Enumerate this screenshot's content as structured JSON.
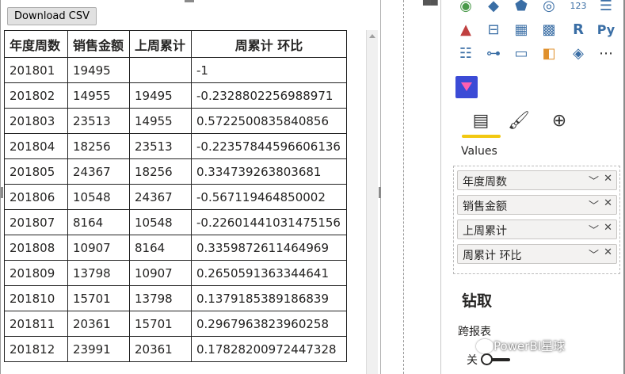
{
  "visual": {
    "download_label": "Download CSV",
    "columns": [
      "年度周数",
      "销售金额",
      "上周累计",
      "周累计 环比"
    ],
    "rows": [
      [
        "201801",
        "19495",
        "",
        "-1"
      ],
      [
        "201802",
        "14955",
        "19495",
        "-0.2328802256988971"
      ],
      [
        "201803",
        "23513",
        "14955",
        "0.5722500835840856"
      ],
      [
        "201804",
        "18256",
        "23513",
        "-0.22357844596606136"
      ],
      [
        "201805",
        "24367",
        "18256",
        "0.334739263803681"
      ],
      [
        "201806",
        "10548",
        "24367",
        "-0.567119464850002"
      ],
      [
        "201807",
        "8164",
        "10548",
        "-0.22601441031475156"
      ],
      [
        "201808",
        "10907",
        "8164",
        "0.3359872611464969"
      ],
      [
        "201809",
        "13798",
        "10907",
        "0.2650591363344641"
      ],
      [
        "201810",
        "15701",
        "13798",
        "0.1379185389186839"
      ],
      [
        "201811",
        "20361",
        "15701",
        "0.2967963823960258"
      ],
      [
        "201812",
        "23991",
        "20361",
        "0.17828200972447328"
      ]
    ]
  },
  "pane": {
    "values_label": "Values",
    "wells": [
      "年度周数",
      "销售金额",
      "上周累计",
      "周累计 环比"
    ],
    "drill_title": "钻取",
    "cross_report_label": "跨报表",
    "toggle_off_label": "关",
    "accent": "#f2c811",
    "icons": [
      "globe-map-icon",
      "filled-map-icon",
      "shape-map-icon",
      "arcgis-icon",
      "card-123-icon",
      "multi-row-card-icon",
      "kpi-icon",
      "slicer-icon",
      "table-icon",
      "matrix-icon",
      "r-script-icon",
      "python-icon",
      "key-influencers-icon",
      "decomposition-tree-icon",
      "qa-icon",
      "smart-narrative-icon",
      "paginated-visual-icon",
      "more-icon",
      "custom-visual-icon",
      "fields-tab-icon",
      "format-tab-icon",
      "analytics-tab-icon"
    ]
  },
  "watermark": "PowerBI星球"
}
